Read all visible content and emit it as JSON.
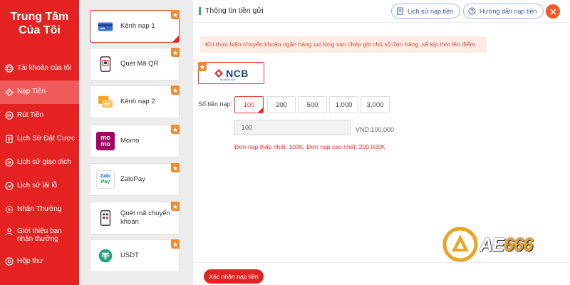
{
  "sidebar": {
    "title_line1": "Trung Tâm",
    "title_line2": "Của Tôi",
    "items": [
      {
        "label": "Tài khoản của tôi",
        "icon": "account-icon"
      },
      {
        "label": "Nạp Tiền",
        "icon": "deposit-icon",
        "active": true
      },
      {
        "label": "Rút Tiền",
        "icon": "withdraw-icon"
      },
      {
        "label": "Lịch Sử Đặt Cược",
        "icon": "bet-history-icon"
      },
      {
        "label": "Lịch sử giao dịch",
        "icon": "transaction-history-icon"
      },
      {
        "label": "Lịch sử lãi lỗ",
        "icon": "profit-loss-icon"
      },
      {
        "label": "Nhận Thưởng",
        "icon": "reward-icon"
      },
      {
        "label": "Giới thiệu bạn nhận thưởng",
        "icon": "referral-icon"
      },
      {
        "label": "Hộp thư",
        "icon": "mailbox-icon"
      }
    ]
  },
  "channels": [
    {
      "label": "Kênh nạp 1",
      "icon": "bank-card-icon",
      "active": true
    },
    {
      "label": "Quét Mã QR",
      "icon": "qr-phone-icon"
    },
    {
      "label": "Kênh nạp 2",
      "icon": "transfer-icon"
    },
    {
      "label": "Momo",
      "icon": "momo-logo",
      "logo_text_1": "mo",
      "logo_text_2": "mo"
    },
    {
      "label": "ZaloPay",
      "icon": "zalopay-logo",
      "logo_text_1": "Zalo",
      "logo_text_2": "Pay"
    },
    {
      "label": "Quét mã chuyển khoản",
      "icon": "qr-transfer-icon"
    },
    {
      "label": "USDT",
      "icon": "usdt-logo"
    }
  ],
  "main": {
    "title": "Thông tin tiền gửi",
    "history_button": "Lịch sử nạp tiền",
    "guide_button": "Hướng dẫn nạp tiền",
    "notice": "Khi thực hiện chuyển khoản ngân hàng vui lòng sao chép ghi chú số đơn hàng ,sẽ kịp thời lên điểm.",
    "bank": {
      "name": "NCB",
      "subtitle": "NH QUỐC DÂN"
    },
    "amount_label": "Số tiền nạp:",
    "amount_options": [
      "100",
      "200",
      "500",
      "1,000",
      "3,000"
    ],
    "selected_amount_index": 0,
    "amount_value": "100",
    "vnd_text": "VND:100,000",
    "limits_text": "Đơn nạp thấp nhất:  100K,   Đơn nạp cao nhất:   200,000K",
    "confirm_button": "Xác nhận nạp tiền"
  },
  "brand": {
    "text_a": "AE",
    "text_b": "666"
  },
  "colors": {
    "primary": "#e42222",
    "accent": "#f08a30",
    "link": "#3c5aa6",
    "title_bar": "#2fb344"
  }
}
